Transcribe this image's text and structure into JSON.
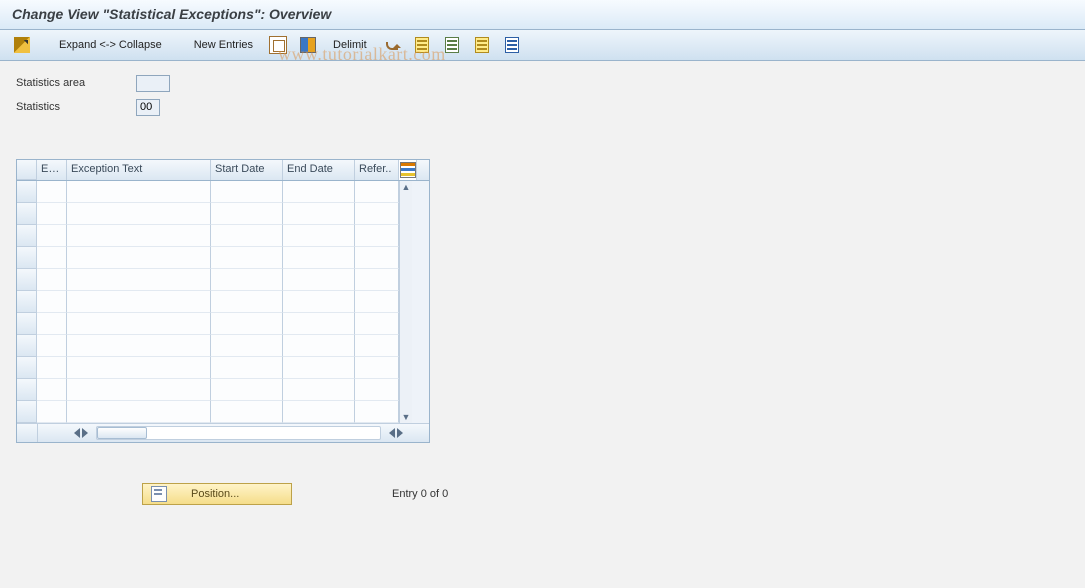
{
  "title": "Change View \"Statistical Exceptions\": Overview",
  "toolbar": {
    "expand_collapse": "Expand <-> Collapse",
    "new_entries": "New Entries",
    "delimit": "Delimit"
  },
  "fields": {
    "stats_area_label": "Statistics area",
    "stats_area_value": "",
    "stats_label": "Statistics",
    "stats_value": "00"
  },
  "table": {
    "columns": {
      "ex": "Ex...",
      "exception_text": "Exception Text",
      "start_date": "Start Date",
      "end_date": "End Date",
      "refer": "Refer.."
    },
    "row_count": 11
  },
  "footer": {
    "position_label": "Position...",
    "entry_text": "Entry 0 of 0"
  },
  "watermark": "www.tutorialkart.com"
}
